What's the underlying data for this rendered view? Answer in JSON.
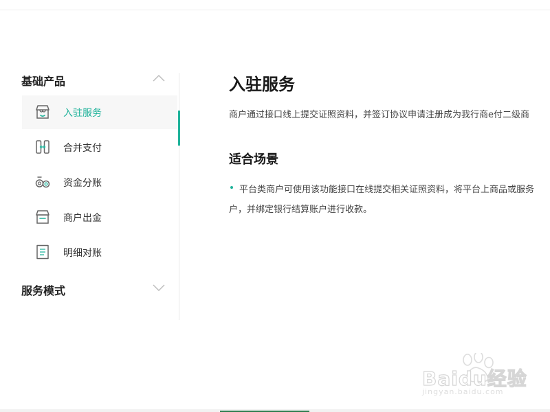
{
  "sidebar": {
    "groups": [
      {
        "title": "基础产品",
        "expanded": true,
        "chevron_icon": "chevron-up-icon",
        "items": [
          {
            "label": "入驻服务",
            "icon": "store-icon",
            "active": true
          },
          {
            "label": "合并支付",
            "icon": "merge-payment-icon",
            "active": false
          },
          {
            "label": "资金分账",
            "icon": "fund-split-icon",
            "active": false
          },
          {
            "label": "商户出金",
            "icon": "merchant-withdraw-icon",
            "active": false
          },
          {
            "label": "明细对账",
            "icon": "receipt-icon",
            "active": false
          }
        ]
      },
      {
        "title": "服务模式",
        "expanded": false,
        "chevron_icon": "chevron-down-icon",
        "items": []
      }
    ]
  },
  "main": {
    "title": "入驻服务",
    "intro": "商户通过接口线上提交证照资料，并签订协议申请注册成为我行商e付二级商",
    "section_title": "适合场景",
    "scenario_lines": [
      "平台类商户可使用该功能接口在线提交相关证照资料，将平台上商品或服务",
      "户，并绑定银行结算账户进行收款。"
    ]
  },
  "watermark": {
    "brand": "Baidu经验",
    "sub": "jingyan.baidu.com"
  },
  "colors": {
    "accent": "#1eb29a",
    "active_bg": "#f7f7f7",
    "divider": "#e8e8e8",
    "heading": "#1a1a1a",
    "body_text": "#444444"
  }
}
